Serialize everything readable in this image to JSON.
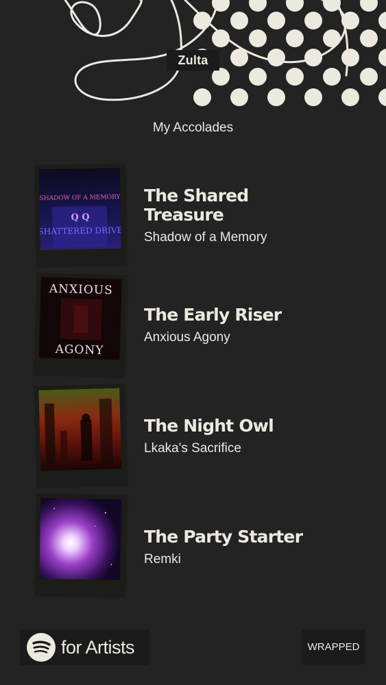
{
  "artist": {
    "name": "Zulta"
  },
  "section": {
    "title": "My Accolades"
  },
  "accolades": [
    {
      "title_line1": "The Shared",
      "title_line2": "Treasure",
      "track": "Shadow of a Memory",
      "cover_text_top": "SHADOW OF A MEMORY",
      "cover_text_mid": "Q  Q",
      "cover_text_bottom": "SHATTERED DRIVE",
      "cover_icon": "album-cover-shadow-of-a-memory"
    },
    {
      "title_line1": "The Early Riser",
      "title_line2": "",
      "track": "Anxious Agony",
      "cover_text_top": "ANXIOUS",
      "cover_text_bottom": "AGONY",
      "cover_icon": "album-cover-anxious-agony"
    },
    {
      "title_line1": "The Night Owl",
      "title_line2": "",
      "track": "Lkaka's Sacrifice",
      "cover_icon": "album-cover-lkakas-sacrifice"
    },
    {
      "title_line1": "The Party Starter",
      "title_line2": "",
      "track": "Remki",
      "cover_icon": "album-cover-remki"
    }
  ],
  "footer": {
    "logo_text": "for Artists",
    "logo_icon": "spotify-icon",
    "wrapped_label": "WRAPPED"
  },
  "colors": {
    "background": "#232323",
    "text": "#ece9df",
    "dark_panel": "#1b1b1b"
  }
}
